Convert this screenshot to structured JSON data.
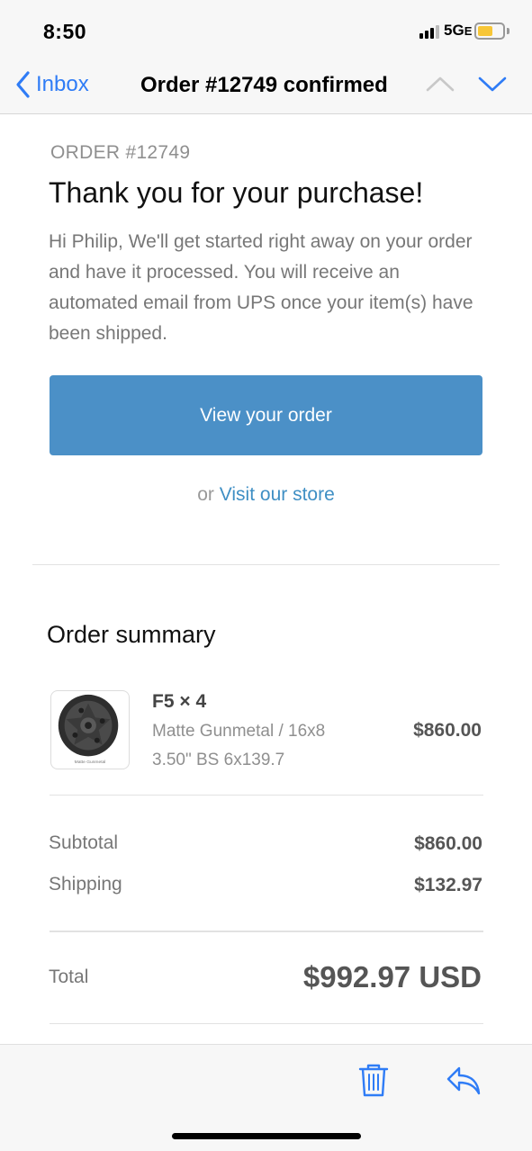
{
  "status_bar": {
    "time": "8:50",
    "network": "5G",
    "network_suffix": "E"
  },
  "nav": {
    "back_label": "Inbox",
    "title": "Order #12749 confirmed"
  },
  "email": {
    "order_number": "ORDER #12749",
    "headline": "Thank you for your purchase!",
    "intro": "Hi Philip, We'll get started right away on your order and have it processed. You will receive an automated email from UPS once your item(s) have been shipped.",
    "view_button": "View your order",
    "store_prefix": "or",
    "store_link": "Visit our store"
  },
  "summary": {
    "title": "Order summary",
    "items": [
      {
        "name": "F5 × 4",
        "variant": "Matte Gunmetal / 16x8",
        "spec": "3.50\" BS 6x139.7",
        "price": "$860.00",
        "thumb_caption": "Matte Gunmetal"
      }
    ],
    "subtotal_label": "Subtotal",
    "subtotal_value": "$860.00",
    "shipping_label": "Shipping",
    "shipping_value": "$132.97",
    "total_label": "Total",
    "total_value": "$992.97 USD"
  },
  "colors": {
    "accent": "#2f7cf6",
    "button": "#4b90c7",
    "link": "#3f8fc4",
    "battery": "#f7c637"
  },
  "icons": [
    "chevron-left-icon",
    "chevron-up-icon",
    "chevron-down-icon",
    "trash-icon",
    "reply-icon"
  ]
}
